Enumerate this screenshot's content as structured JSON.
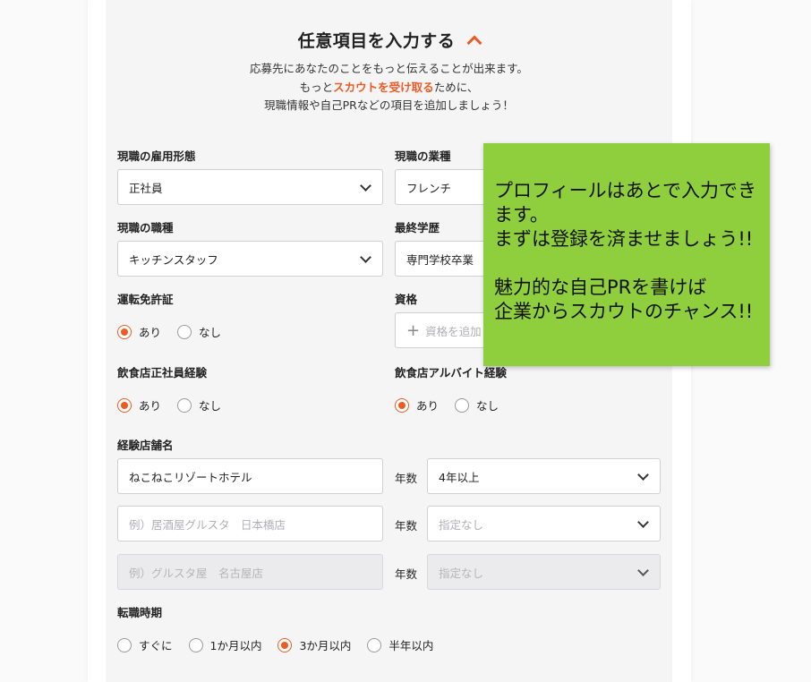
{
  "section": {
    "title": "任意項目を入力する",
    "desc_line1": "応募先にあなたのことをもっと伝えることが出来ます。",
    "desc_line2_pre": "もっと",
    "desc_line2_accent": "スカウトを受け取る",
    "desc_line2_post": "ために、",
    "desc_line3": "現職情報や自己PRなどの項目を追加しましょう！"
  },
  "fields": {
    "employment_type": {
      "label": "現職の雇用形態",
      "value": "正社員"
    },
    "industry": {
      "label": "現職の業種",
      "value": "フレンチ"
    },
    "job_type": {
      "label": "現職の職種",
      "value": "キッチンスタッフ"
    },
    "education": {
      "label": "最終学歴",
      "value": "専門学校卒業"
    },
    "license": {
      "label": "運転免許証",
      "options": [
        "あり",
        "なし"
      ],
      "selected": "あり"
    },
    "qualification": {
      "label": "資格",
      "add_label": "資格を追加"
    },
    "restaurant_fulltime": {
      "label": "飲食店正社員経験",
      "options": [
        "あり",
        "なし"
      ],
      "selected": "あり"
    },
    "restaurant_parttime": {
      "label": "飲食店アルバイト経験",
      "options": [
        "あり",
        "なし"
      ],
      "selected": "あり"
    },
    "store_names": {
      "label": "経験店舗名",
      "years_label": "年数",
      "rows": [
        {
          "store_value": "ねこねこリゾートホテル",
          "store_placeholder": "",
          "years_value": "4年以上"
        },
        {
          "store_value": "",
          "store_placeholder": "例）居酒屋グルスタ　日本橋店",
          "years_value": "指定なし"
        },
        {
          "store_value": "",
          "store_placeholder": "例）グルスタ屋　名古屋店",
          "years_value": "指定なし"
        }
      ]
    },
    "change_timing": {
      "label": "転職時期",
      "options": [
        "すぐに",
        "1か月以内",
        "3か月以内",
        "半年以内"
      ],
      "selected": "3か月以内"
    }
  },
  "tooltip": {
    "line1": "プロフィールはあとで入力でき",
    "line2": "ます。",
    "line3": "まずは登録を済ませましょう!!",
    "line4": "魅力的な自己PRを書けば",
    "line5": "企業からスカウトのチャンス!!"
  },
  "colors": {
    "accent": "#ee5a24",
    "tooltip_bg": "#8fce3c",
    "panel_bg": "#f5f5f6"
  }
}
